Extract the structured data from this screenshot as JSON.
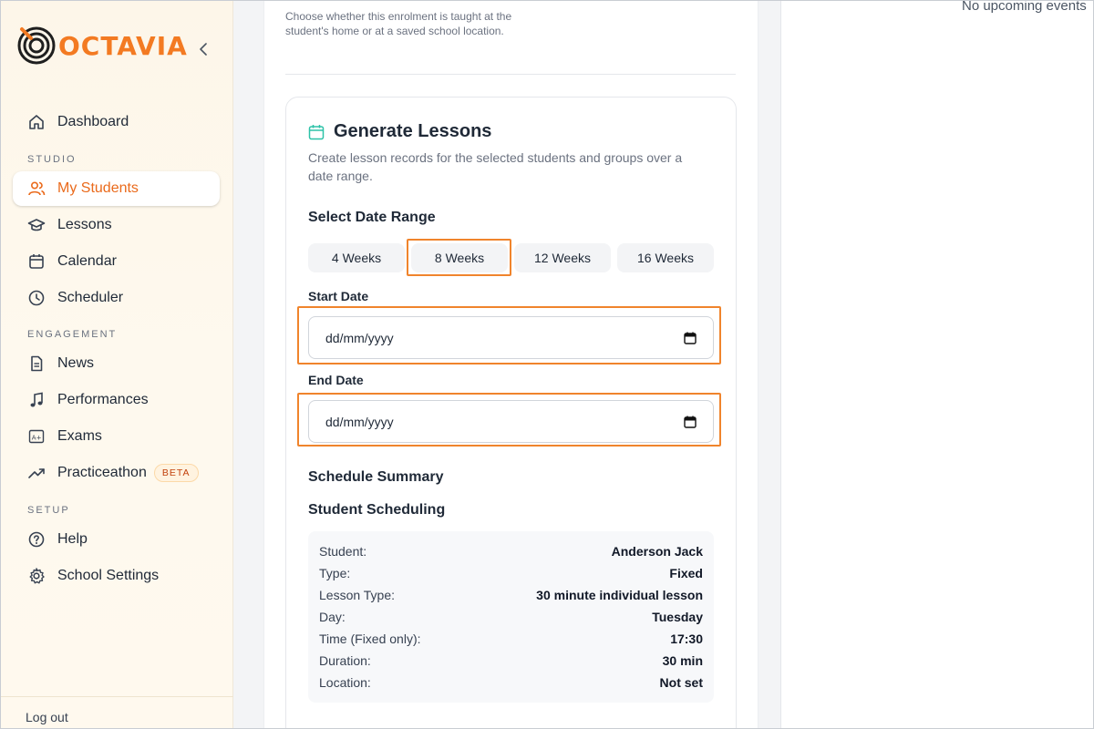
{
  "brand": {
    "name": "OCTAVIA",
    "accent": "#f37a22"
  },
  "sidebar": {
    "collapse_icon": "chevron-left-icon",
    "dashboard": "Dashboard",
    "sections": {
      "studio": "STUDIO",
      "engagement": "ENGAGEMENT",
      "setup": "SETUP"
    },
    "items": {
      "my_students": "My Students",
      "lessons": "Lessons",
      "calendar": "Calendar",
      "scheduler": "Scheduler",
      "news": "News",
      "performances": "Performances",
      "exams": "Exams",
      "practiceathon": "Practiceathon",
      "beta_badge": "BETA",
      "help": "Help",
      "school_settings": "School Settings"
    },
    "active_item": "My Students",
    "logout": "Log out"
  },
  "location_help": "Choose whether this enrolment is taught at the student's home or at a saved school location.",
  "generate": {
    "title": "Generate Lessons",
    "description": "Create lesson records for the selected students and groups over a date range.",
    "select_range_label": "Select Date Range",
    "ranges": [
      "4 Weeks",
      "8 Weeks",
      "12 Weeks",
      "16 Weeks"
    ],
    "selected_range": "8 Weeks",
    "start_date_label": "Start Date",
    "start_date_value": "dd/mm/yyyy",
    "end_date_label": "End Date",
    "end_date_value": "dd/mm/yyyy",
    "schedule_summary_label": "Schedule Summary",
    "student_scheduling_label": "Student Scheduling",
    "summary": [
      {
        "k": "Student:",
        "v": "Anderson Jack"
      },
      {
        "k": "Type:",
        "v": "Fixed"
      },
      {
        "k": "Lesson Type:",
        "v": "30 minute individual lesson"
      },
      {
        "k": "Day:",
        "v": "Tuesday"
      },
      {
        "k": "Time (Fixed only):",
        "v": "17:30"
      },
      {
        "k": "Duration:",
        "v": "30 min"
      },
      {
        "k": "Location:",
        "v": "Not set"
      }
    ]
  },
  "right_panel": {
    "no_events": "No upcoming events"
  }
}
